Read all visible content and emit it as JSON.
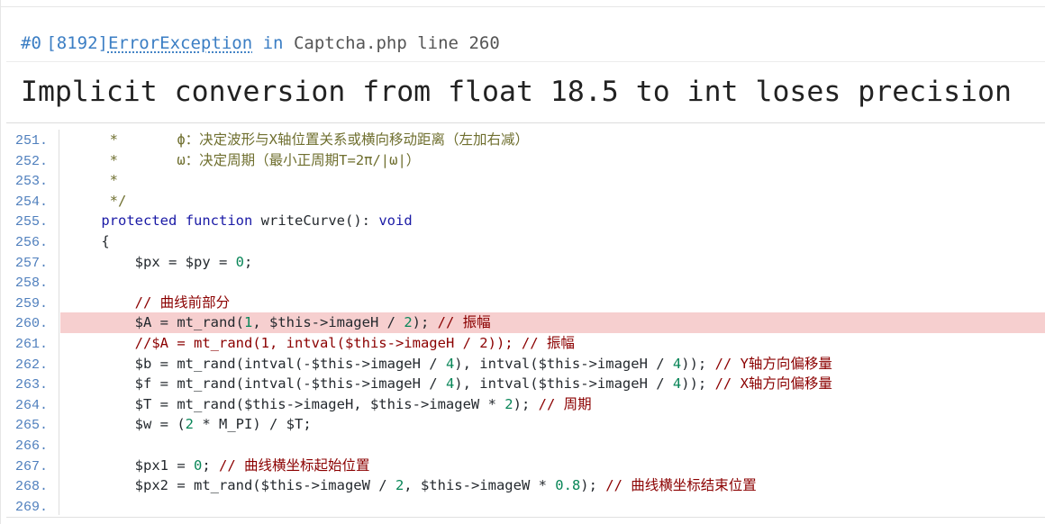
{
  "header": {
    "frame_index": "#0",
    "error_code": "[8192]",
    "exception_class": "ErrorException",
    "in_word": "in",
    "file": "Captcha.php",
    "line_word": "line",
    "line_number": "260"
  },
  "message": "Implicit conversion from float 18.5 to int loses precision",
  "code": {
    "highlight_line": "260",
    "lines": [
      {
        "n": "251.",
        "text": "  *       ϕ：决定波形与X轴位置关系或横向移动距离（左加右减）"
      },
      {
        "n": "252.",
        "text": "  *       ω：决定周期（最小正周期T=2π/|ω|）"
      },
      {
        "n": "253.",
        "text": "  *"
      },
      {
        "n": "254.",
        "text": "  */"
      },
      {
        "n": "255.",
        "text": " protected function writeCurve(): void"
      },
      {
        "n": "256.",
        "text": " {"
      },
      {
        "n": "257.",
        "text": "     $px = $py = 0;"
      },
      {
        "n": "258.",
        "text": ""
      },
      {
        "n": "259.",
        "text": "     // 曲线前部分"
      },
      {
        "n": "260.",
        "text": "     $A = mt_rand(1, $this->imageH / 2); // 振幅"
      },
      {
        "n": "261.",
        "text": "     //$A = mt_rand(1, intval($this->imageH / 2)); // 振幅"
      },
      {
        "n": "262.",
        "text": "     $b = mt_rand(intval(-$this->imageH / 4), intval($this->imageH / 4)); // Y轴方向偏移量"
      },
      {
        "n": "263.",
        "text": "     $f = mt_rand(intval(-$this->imageH / 4), intval($this->imageH / 4)); // X轴方向偏移量"
      },
      {
        "n": "264.",
        "text": "     $T = mt_rand($this->imageH, $this->imageW * 2); // 周期"
      },
      {
        "n": "265.",
        "text": "     $w = (2 * M_PI) / $T;"
      },
      {
        "n": "266.",
        "text": ""
      },
      {
        "n": "267.",
        "text": "     $px1 = 0; // 曲线横坐标起始位置"
      },
      {
        "n": "268.",
        "text": "     $px2 = mt_rand($this->imageW / 2, $this->imageW * 0.8); // 曲线横坐标结束位置"
      },
      {
        "n": "269.",
        "text": ""
      }
    ]
  },
  "colors": {
    "line_number": "#4f7fbd",
    "highlight_bg": "#f6cfcf",
    "keyword": "#1a1aa6",
    "comment": "#8b0000",
    "link": "#3b7ec4"
  }
}
